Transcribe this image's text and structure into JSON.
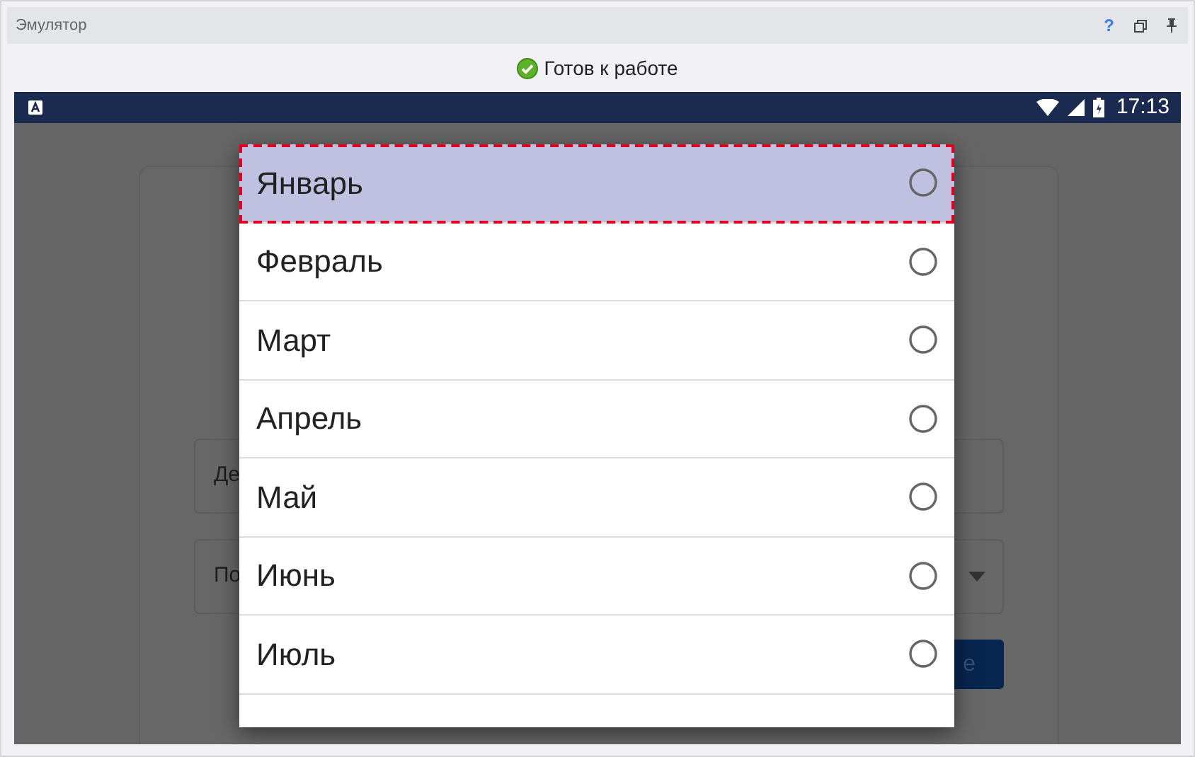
{
  "window": {
    "title": "Эмулятор",
    "help_button": "?"
  },
  "status": {
    "text": "Готов к работе"
  },
  "phone_status_bar": {
    "time": "17:13"
  },
  "background_form": {
    "fields": [
      {
        "text": "Де",
        "kind": "input"
      },
      {
        "text": "По",
        "kind": "select"
      }
    ],
    "button": "е"
  },
  "dialog": {
    "items": [
      {
        "label": "Январь",
        "selected": true,
        "checked": false
      },
      {
        "label": "Февраль",
        "selected": false,
        "checked": false
      },
      {
        "label": "Март",
        "selected": false,
        "checked": false
      },
      {
        "label": "Апрель",
        "selected": false,
        "checked": false
      },
      {
        "label": "Май",
        "selected": false,
        "checked": false
      },
      {
        "label": "Июнь",
        "selected": false,
        "checked": false
      },
      {
        "label": "Июль",
        "selected": false,
        "checked": false
      }
    ]
  }
}
